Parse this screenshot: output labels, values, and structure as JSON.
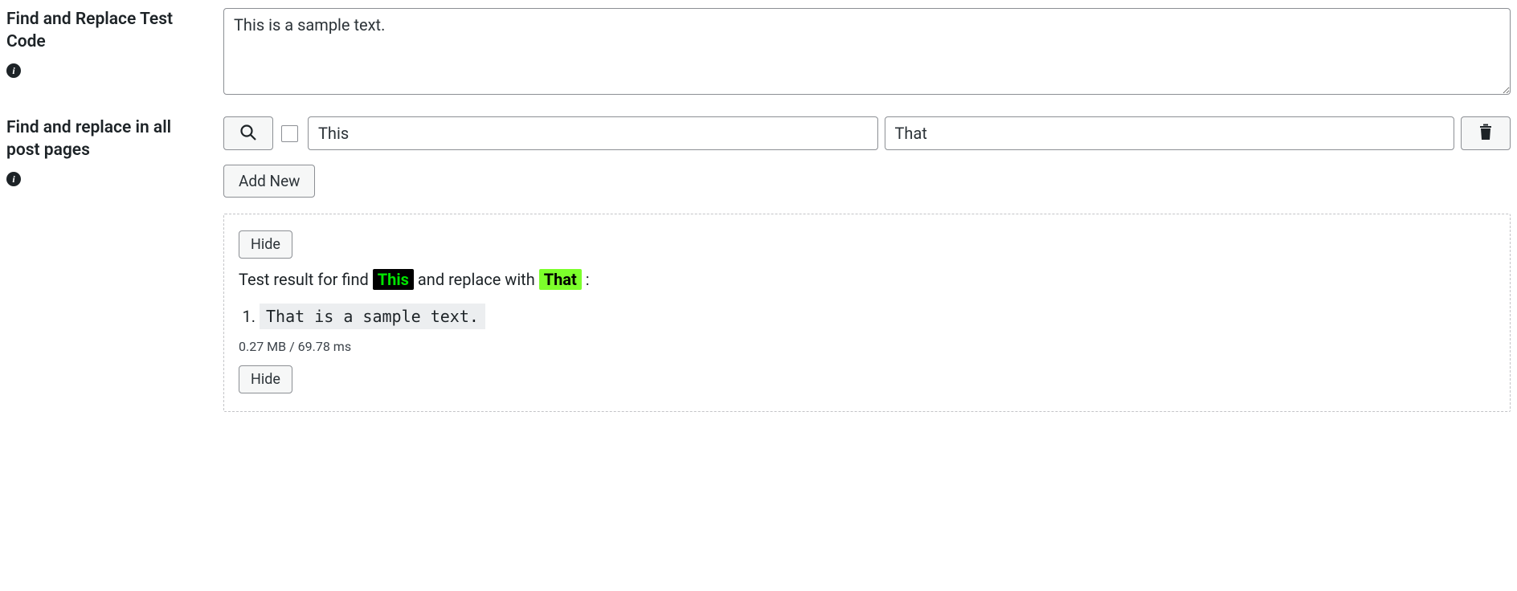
{
  "section1": {
    "label": "Find and Replace Test Code",
    "textarea_value": "This is a sample text."
  },
  "section2": {
    "label": "Find and replace in all post pages",
    "find_value": "This",
    "replace_value": "That",
    "add_new_label": "Add New"
  },
  "result": {
    "hide_label": "Hide",
    "sentence_prefix": "Test result for find ",
    "sentence_mid": " and replace with ",
    "sentence_suffix": " :",
    "find_token": "This",
    "replace_token": "That",
    "items": [
      "That is a sample text."
    ],
    "stats": "0.27 MB / 69.78 ms"
  }
}
